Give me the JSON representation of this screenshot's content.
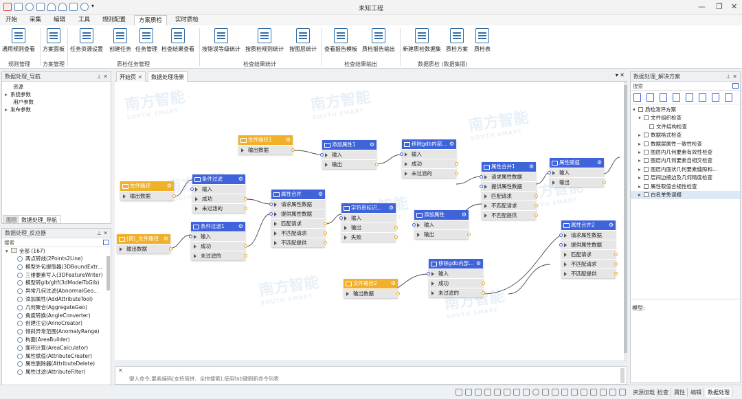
{
  "app": {
    "title": "未知工程"
  },
  "menu": [
    "开始",
    "采集",
    "编辑",
    "工具",
    "规则配置",
    "方案质检",
    "实时质检"
  ],
  "menu_active": "方案质检",
  "ribbon": {
    "buttons": [
      "通用规则查看",
      "方案面板",
      "任务资源设置",
      "创建任务",
      "任务管理",
      "检查结果查看",
      "按错误等级统计",
      "按质检规则统计",
      "按图层统计",
      "查看报告模板",
      "质检报告输出",
      "新建质检数据集",
      "质检方案",
      "质检表"
    ],
    "groups": [
      "规则管理",
      "方案管理",
      "质检任务管理",
      "检查结果统计",
      "检查结果输出",
      "数据质检 (数据集版)"
    ]
  },
  "nav_panel": {
    "title": "数据处理_导航",
    "items": [
      "资源",
      "系统参数",
      "用户参数",
      "发布参数"
    ],
    "tabs": [
      "图层",
      "数据处理_导航"
    ]
  },
  "reactor_panel": {
    "title": "数据处理_反应器",
    "search_label": "搜索",
    "root": "全部 (167)",
    "items": [
      "两点转线(2Points2Line)",
      "模型外包提取器(3DBoundExtr...",
      "三维要素写入(3DFeatureWriter)",
      "模型转glb/gltf(3dModelToGlb)",
      "异常几何过滤(AbnormalGeo...",
      "添加属性(AddAttributeTool)",
      "几何聚合(AggregateGeo)",
      "角度转换(AngleConverter)",
      "创建注记(AnnoCreator)",
      "倾斜异常范围(AnomalyRange)",
      "构面(AreaBuilder)",
      "面积计算(AreaCalculator)",
      "属性赋值(AttributeCreater)",
      "属性删除器(AttributeDelete)",
      "属性过滤(AttributeFilter)"
    ]
  },
  "doc_tabs": [
    "开始页",
    "数据处理场景"
  ],
  "watermark": {
    "cn": "南方智能",
    "en": "SOUTH SMART"
  },
  "nodes": [
    {
      "title": "文件路径",
      "ports": [
        "输出数据"
      ]
    },
    {
      "title": "(调)_文件路径",
      "ports": [
        "输出数据"
      ]
    },
    {
      "title": "条件过滤",
      "ports": [
        "输入",
        "成功",
        "未过滤的"
      ]
    },
    {
      "title": "条件过滤1",
      "ports": [
        "输入",
        "成功",
        "未过滤的"
      ]
    },
    {
      "title": "文件路径1",
      "ports": [
        "输出数据"
      ]
    },
    {
      "title": "属性合并",
      "ports": [
        "请求属性数据",
        "提供属性数据",
        "匹配请求",
        "不匹配请求",
        "不匹配提供"
      ]
    },
    {
      "title": "添加属性1",
      "ports": [
        "输入",
        "输出"
      ]
    },
    {
      "title": "字符串标识...",
      "ports": [
        "输入",
        "输出",
        "失败"
      ]
    },
    {
      "title": "移除gdb内部...",
      "ports": [
        "输入",
        "成功",
        "未过滤的"
      ]
    },
    {
      "title": "添加属性",
      "ports": [
        "输入",
        "输出"
      ]
    },
    {
      "title": "属性合并1",
      "ports": [
        "请求属性数据",
        "提供属性数据",
        "匹配请求",
        "不匹配请求",
        "不匹配提供"
      ]
    },
    {
      "title": "属性赋值",
      "ports": [
        "输入",
        "输出"
      ]
    },
    {
      "title": "移除gdb内部...",
      "ports": [
        "输入",
        "成功",
        "未过滤的"
      ]
    },
    {
      "title": "文件路径2",
      "ports": [
        "输出数据"
      ]
    },
    {
      "title": "属性合并2",
      "ports": [
        "请求属性数据",
        "提供属性数据",
        "匹配请求",
        "不匹配请求",
        "不匹配提供"
      ]
    }
  ],
  "cmd_placeholder": "键入命令,要素编码(支持简拼、全拼搜索),使用tab键刷新命令列表",
  "solution_panel": {
    "title": "数据处理_解决方案",
    "search_label": "搜索",
    "items": [
      "质检测评方案",
      "文件组织检查",
      "文件结构检查",
      "数据格式检查",
      "数据层属性一致性检查",
      "图层内几何要素有效性检查",
      "图层内几何要素自相交检查",
      "图层内面状几何要素缝隙和...",
      "层间边接边及几何精度检查",
      "属性取值合规性检查",
      "白名单免误报"
    ],
    "model_label": "模型:"
  },
  "bottom_tabs": [
    "资源加载",
    "检查",
    "属性",
    "编辑",
    "数据处理"
  ]
}
